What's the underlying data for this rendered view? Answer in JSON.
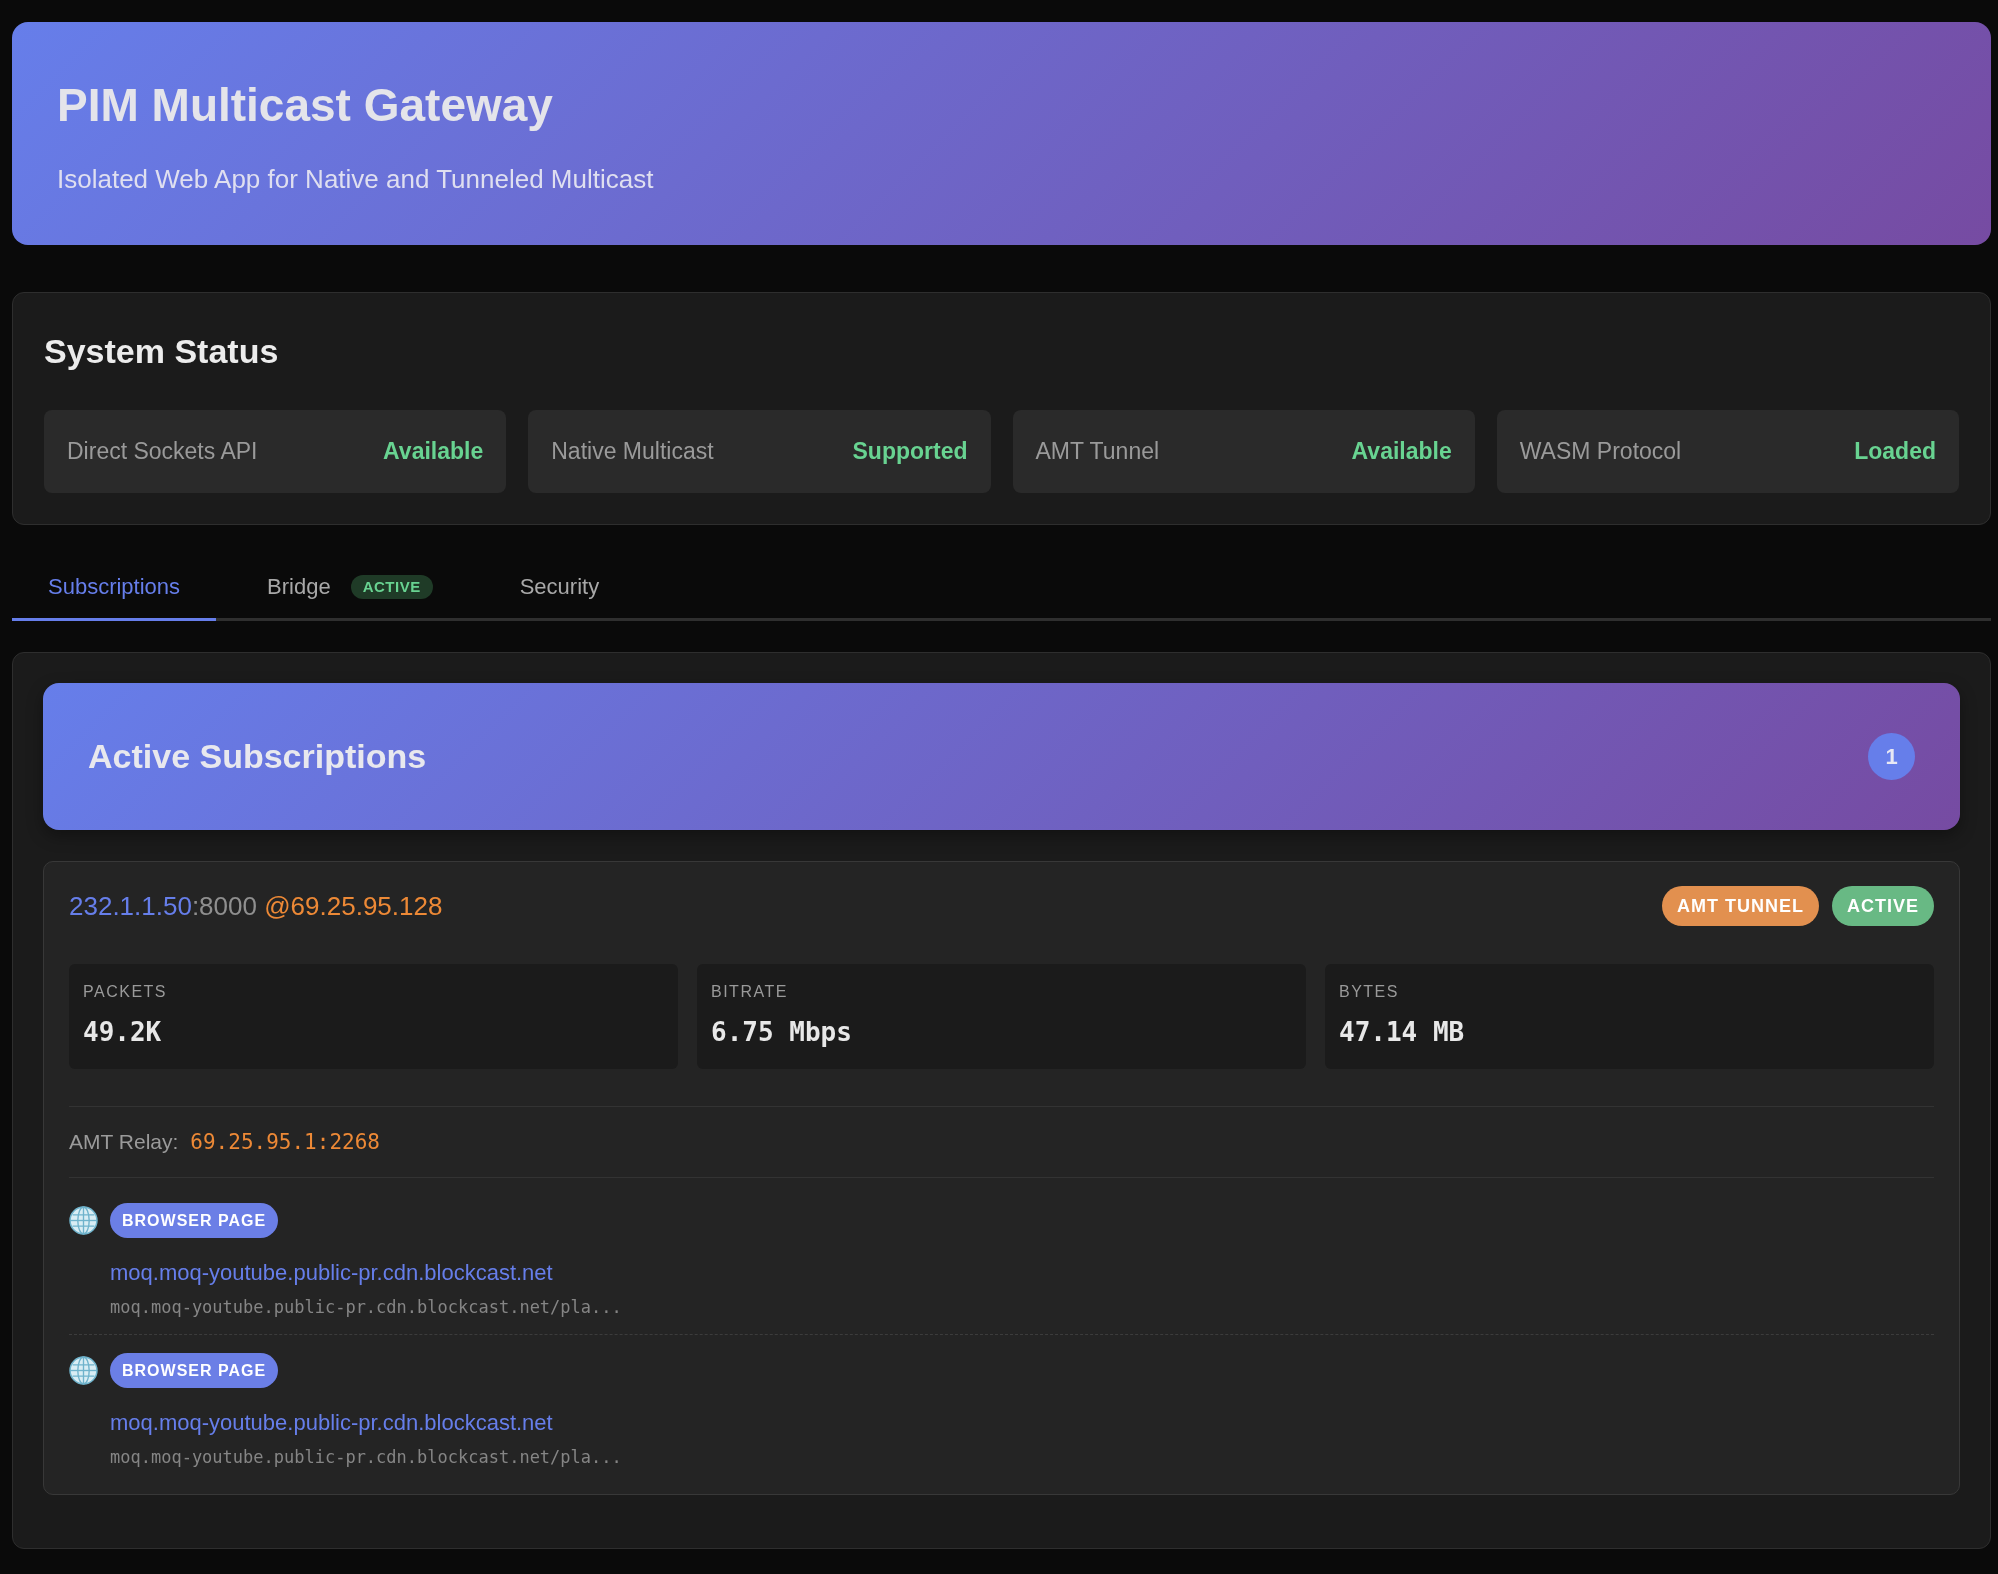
{
  "header": {
    "title": "PIM Multicast Gateway",
    "subtitle": "Isolated Web App for Native and Tunneled Multicast"
  },
  "system_status": {
    "title": "System Status",
    "items": [
      {
        "label": "Direct Sockets API",
        "value": "Available",
        "ok": true
      },
      {
        "label": "Native Multicast",
        "value": "Supported",
        "ok": true
      },
      {
        "label": "AMT Tunnel",
        "value": "Available",
        "ok": true
      },
      {
        "label": "WASM Protocol",
        "value": "Loaded",
        "ok": true
      }
    ]
  },
  "tabs": [
    {
      "label": "Subscriptions",
      "selected": true
    },
    {
      "label": "Bridge",
      "selected": false,
      "badge": "ACTIVE"
    },
    {
      "label": "Security",
      "selected": false
    }
  ],
  "subscriptions": {
    "title": "Active Subscriptions",
    "count": "1",
    "items": [
      {
        "group": "232.1.1.50",
        "port": ":8000",
        "source": "@69.25.95.128",
        "badges": [
          {
            "label": "AMT TUNNEL",
            "kind": "tunnel"
          },
          {
            "label": "ACTIVE",
            "kind": "status"
          }
        ],
        "stats": [
          {
            "label": "PACKETS",
            "value": "49.2K"
          },
          {
            "label": "BITRATE",
            "value": "6.75 Mbps"
          },
          {
            "label": "BYTES",
            "value": "47.14 MB"
          }
        ],
        "relay": {
          "label": "AMT Relay:",
          "value": "69.25.95.1:2268"
        },
        "pages": [
          {
            "type": "BROWSER PAGE",
            "title": "moq.moq-youtube.public-pr.cdn.blockcast.net",
            "url": "moq.moq-youtube.public-pr.cdn.blockcast.net/pla..."
          },
          {
            "type": "BROWSER PAGE",
            "title": "moq.moq-youtube.public-pr.cdn.blockcast.net",
            "url": "moq.moq-youtube.public-pr.cdn.blockcast.net/pla..."
          }
        ]
      }
    ]
  }
}
